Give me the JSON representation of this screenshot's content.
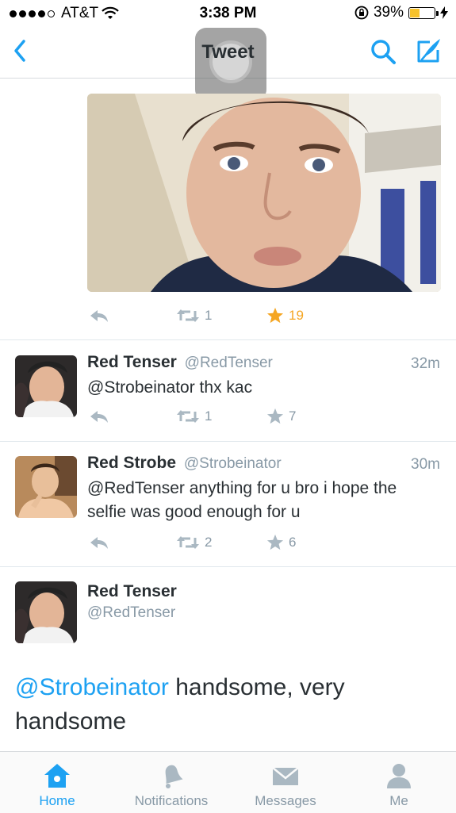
{
  "status_bar": {
    "carrier": "AT&T",
    "time": "3:38 PM",
    "battery_percent": "39%",
    "battery_level": 0.39
  },
  "nav": {
    "title": "Tweet"
  },
  "main_tweet_actions": {
    "retweets": "1",
    "favorites": "19"
  },
  "replies": [
    {
      "name": "Red Tenser",
      "handle": "@RedTenser",
      "time": "32m",
      "text": "@Strobeinator thx kac",
      "retweets": "1",
      "favorites": "7"
    },
    {
      "name": "Red Strobe",
      "handle": "@Strobeinator",
      "time": "30m",
      "text": "@RedTenser anything for u bro i hope the selfie was good enough for u",
      "retweets": "2",
      "favorites": "6"
    }
  ],
  "focus_tweet": {
    "name": "Red Tenser",
    "handle": "@RedTenser",
    "mention": "@Strobeinator",
    "text": " handsome, very handsome"
  },
  "tabs": [
    {
      "label": "Home",
      "icon": "home-icon",
      "active": true
    },
    {
      "label": "Notifications",
      "icon": "bell-icon",
      "active": false
    },
    {
      "label": "Messages",
      "icon": "envelope-icon",
      "active": false
    },
    {
      "label": "Me",
      "icon": "person-icon",
      "active": false
    }
  ],
  "colors": {
    "accent": "#1da1f2",
    "favorite_active": "#f5a623",
    "muted": "#8899a6"
  }
}
